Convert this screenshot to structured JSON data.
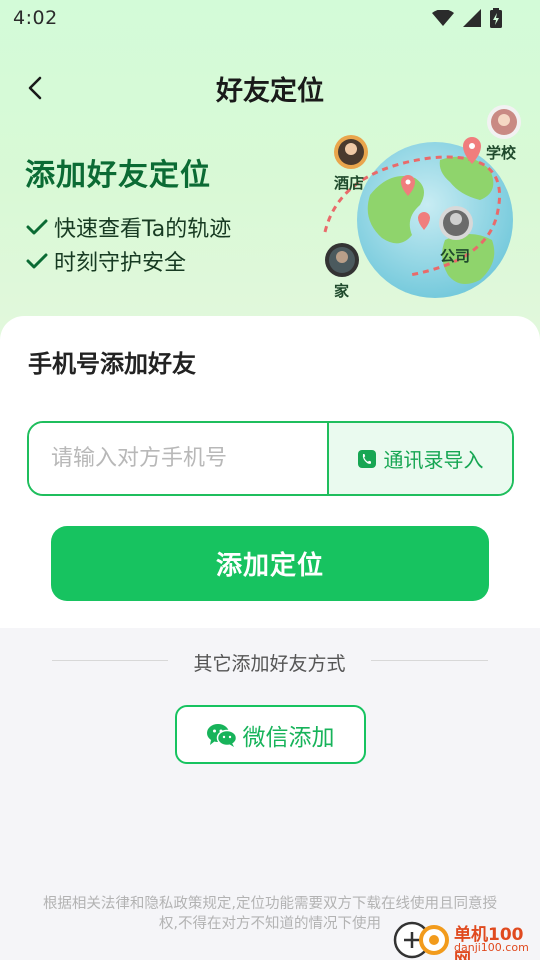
{
  "status_bar": {
    "time": "4:02"
  },
  "nav": {
    "title": "好友定位"
  },
  "hero": {
    "heading": "添加好友定位",
    "features": [
      "快速查看Ta的轨迹",
      "时刻守护安全"
    ],
    "map_labels": {
      "hotel": "酒店",
      "school": "学校",
      "company": "公司",
      "home": "家"
    }
  },
  "phone_section": {
    "title": "手机号添加好友",
    "input_placeholder": "请输入对方手机号",
    "input_value": "",
    "import_contacts_label": "通讯录导入",
    "add_button_label": "添加定位"
  },
  "other_methods": {
    "divider_label": "其它添加好友方式",
    "wechat_button_label": "微信添加"
  },
  "disclaimer": "根据相关法律和隐私政策规定,定位功能需要双方下载在线使用且同意授权,不得在对方不知道的情况下使用",
  "watermark": {
    "brand": "单机100网",
    "domain": "danji100.com"
  },
  "colors": {
    "brand_green": "#17c360",
    "hero_heading_green": "#0b6b34",
    "hero_background": "#d3fbd8",
    "page_background": "#f5f5f8"
  }
}
